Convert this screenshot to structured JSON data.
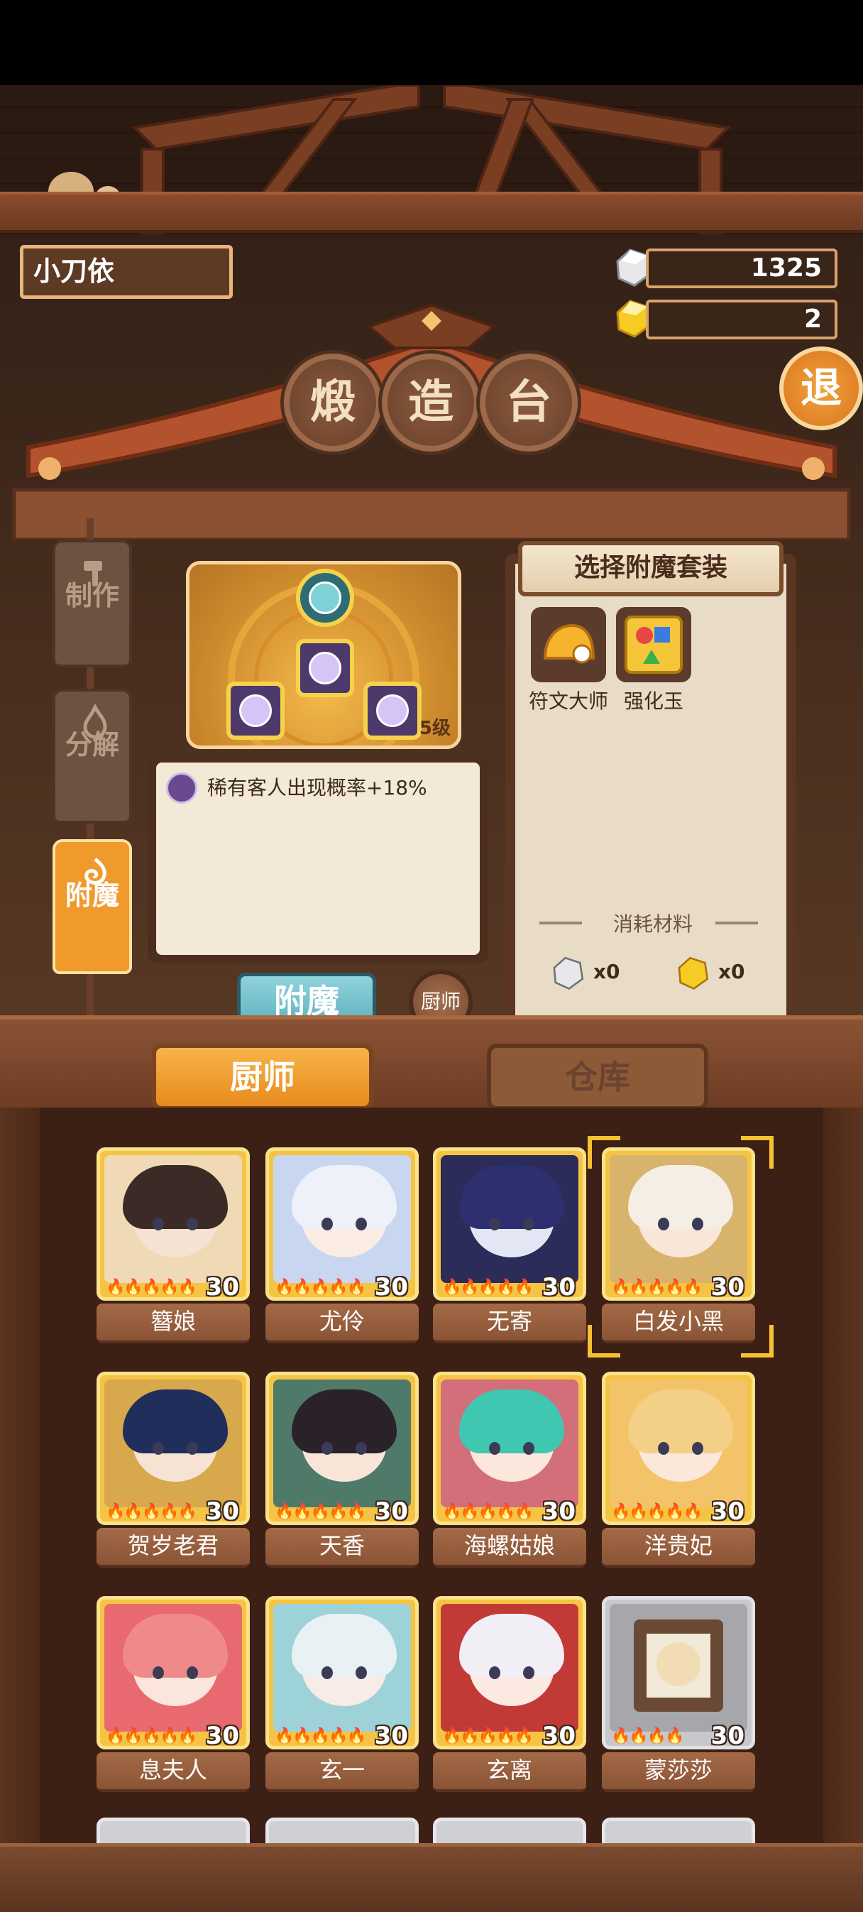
{
  "player": {
    "name": "小刀依"
  },
  "resources": {
    "silver": "1325",
    "gold": "2"
  },
  "exit_label": "退",
  "title": [
    "煅",
    "造",
    "台"
  ],
  "side_tabs": [
    {
      "label": "制作",
      "icon": "hammer-icon",
      "active": false
    },
    {
      "label": "分解",
      "icon": "flame-icon",
      "active": false
    },
    {
      "label": "附魔",
      "icon": "swirl-icon",
      "active": true
    }
  ],
  "enchant": {
    "level": "5级",
    "effect": "稀有客人出现概率+18%",
    "enchant_button": "附魔",
    "chef_button": "厨师"
  },
  "suit": {
    "title": "选择附魔套装",
    "items": [
      {
        "label": "符文大师"
      },
      {
        "label": "强化玉"
      }
    ],
    "cost_label": "消耗材料",
    "costs": [
      {
        "amount": "x0",
        "icon": "silver-ore-icon"
      },
      {
        "amount": "x0",
        "icon": "gold-ore-icon"
      }
    ]
  },
  "tabs": {
    "chef": "厨师",
    "warehouse": "仓库"
  },
  "chefs": [
    {
      "name": "簪娘",
      "level": "30",
      "flames": "🔥🔥🔥🔥🔥",
      "hair": "#3b2a25",
      "skin": "#f6e2d3",
      "bg": "#f0d9b5"
    },
    {
      "name": "尤伶",
      "level": "30",
      "flames": "🔥🔥🔥🔥🔥",
      "hair": "#eef0fa",
      "skin": "#fbece4",
      "bg": "#c9d6f0"
    },
    {
      "name": "无寄",
      "level": "30",
      "flames": "🔥🔥🔥🔥🔥",
      "hair": "#2e2f6e",
      "skin": "#e3e7f4",
      "bg": "#2b2c5a"
    },
    {
      "name": "白发小黑",
      "level": "30",
      "flames": "🔥🔥🔥🔥🔥",
      "hair": "#f4eee4",
      "skin": "#f8e6d6",
      "bg": "#d8b36c"
    },
    {
      "name": "贺岁老君",
      "level": "30",
      "flames": "🔥🔥🔥🔥🔥",
      "hair": "#1f2e5a",
      "skin": "#f6e3d4",
      "bg": "#d8a84c"
    },
    {
      "name": "天香",
      "level": "30",
      "flames": "🔥🔥🔥🔥🔥",
      "hair": "#2a2228",
      "skin": "#f8e5d8",
      "bg": "#4f7a6a"
    },
    {
      "name": "海螺姑娘",
      "level": "30",
      "flames": "🔥🔥🔥🔥🔥",
      "hair": "#3fc7b2",
      "skin": "#fbe7dc",
      "bg": "#d36e7b"
    },
    {
      "name": "洋贵妃",
      "level": "30",
      "flames": "🔥🔥🔥🔥🔥",
      "hair": "#f4cf86",
      "skin": "#fbe8da",
      "bg": "#f3c36a"
    },
    {
      "name": "息夫人",
      "level": "30",
      "flames": "🔥🔥🔥🔥🔥",
      "hair": "#f08a8a",
      "skin": "#fbe6dc",
      "bg": "#e86a70"
    },
    {
      "name": "玄一",
      "level": "30",
      "flames": "🔥🔥🔥🔥🔥",
      "hair": "#e9f1f4",
      "skin": "#f8ece6",
      "bg": "#9dd3d8"
    },
    {
      "name": "玄离",
      "level": "30",
      "flames": "🔥🔥🔥🔥🔥",
      "hair": "#f2eef6",
      "skin": "#fbe9e2",
      "bg": "#c23a36"
    },
    {
      "name": "蒙莎莎",
      "level": "30",
      "flames": "🔥🔥🔥🔥",
      "hair": "#6b4a35",
      "skin": "#f2dcb6",
      "bg": "#a6a6ab"
    }
  ]
}
